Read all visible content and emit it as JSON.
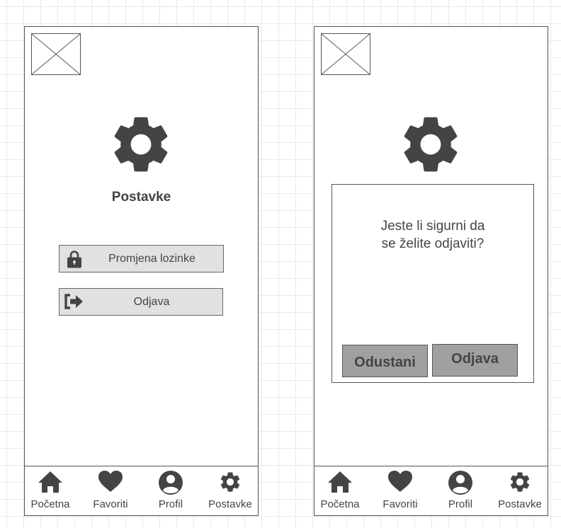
{
  "colors": {
    "icon_dark": "#444444",
    "button_light": "#e1e1e1",
    "button_dark": "#a0a0a0",
    "border": "#555555",
    "grid": "#e9e9e9"
  },
  "settings_screen": {
    "title": "Postavke",
    "buttons": [
      {
        "label": "Promjena lozinke",
        "icon": "lock-icon"
      },
      {
        "label": "Odjava",
        "icon": "sign-out-icon"
      }
    ]
  },
  "logout_dialog": {
    "message_line1": "Jeste li sigurni da",
    "message_line2": "se želite odjaviti?",
    "cancel_label": "Odustani",
    "confirm_label": "Odjava"
  },
  "nav": {
    "items": [
      {
        "label": "Početna",
        "icon": "home-icon"
      },
      {
        "label": "Favoriti",
        "icon": "heart-icon"
      },
      {
        "label": "Profil",
        "icon": "user-icon"
      },
      {
        "label": "Postavke",
        "icon": "gear-icon"
      }
    ]
  }
}
